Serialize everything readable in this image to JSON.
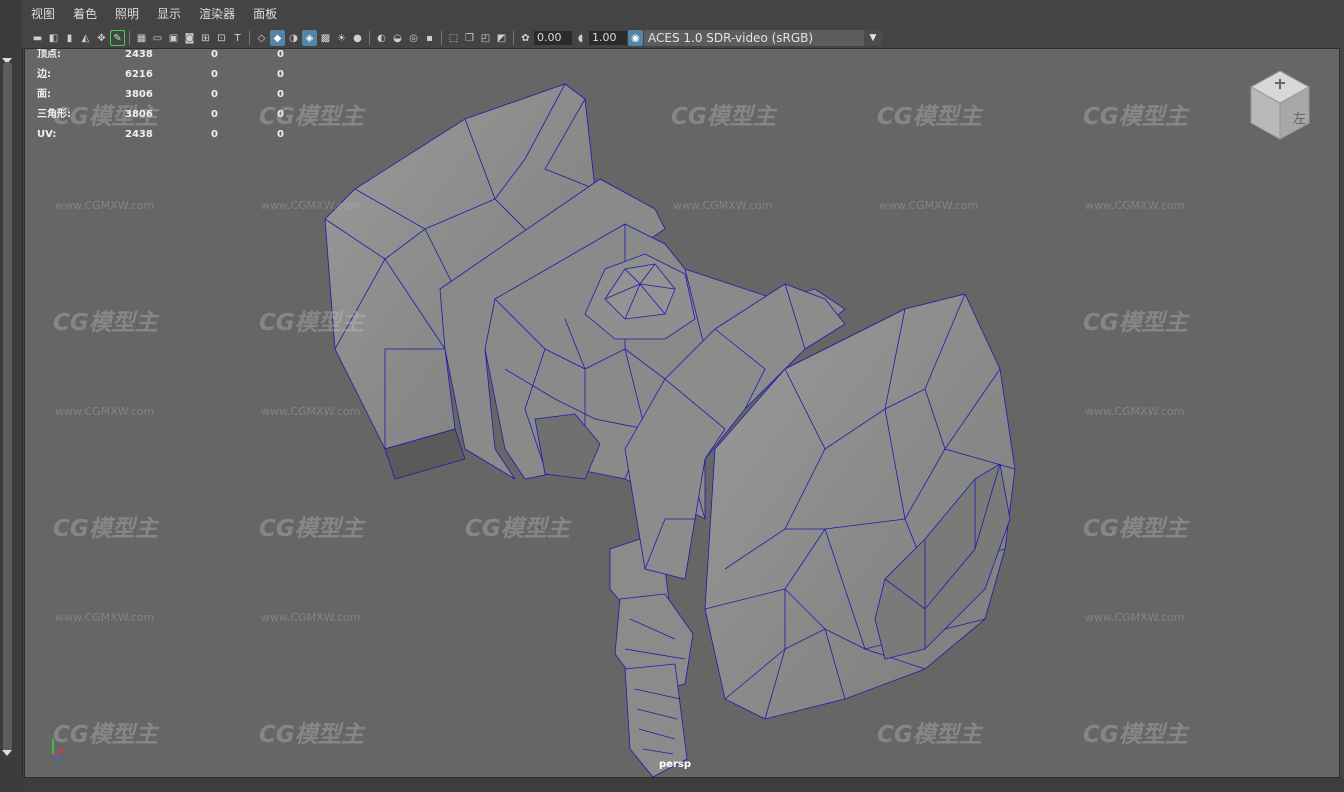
{
  "menu": [
    "视图",
    "着色",
    "照明",
    "显示",
    "渲染器",
    "面板"
  ],
  "toolbar": {
    "exposure": "0.00",
    "gamma": "1.00",
    "colorspace": "ACES 1.0 SDR-video (sRGB)"
  },
  "hud": {
    "rows": [
      {
        "label": "顶点:",
        "v1": "2438",
        "v2": "0",
        "v3": "0"
      },
      {
        "label": "边:",
        "v1": "6216",
        "v2": "0",
        "v3": "0"
      },
      {
        "label": "面:",
        "v1": "3806",
        "v2": "0",
        "v3": "0"
      },
      {
        "label": "三角形:",
        "v1": "3806",
        "v2": "0",
        "v3": "0"
      },
      {
        "label": "UV:",
        "v1": "2438",
        "v2": "0",
        "v3": "0"
      }
    ]
  },
  "viewport": {
    "camera": "persp",
    "watermark": "CG模型主",
    "watermark_url": "www.CGMXW.com"
  },
  "viewcube": {
    "face": "左"
  },
  "axis": {
    "x": "x",
    "y": "y",
    "z": "z"
  },
  "colors": {
    "wire": "#1c1caa",
    "mesh": "#8a8a8a",
    "viewport_bg": "#666666",
    "accent": "#5285a6"
  }
}
